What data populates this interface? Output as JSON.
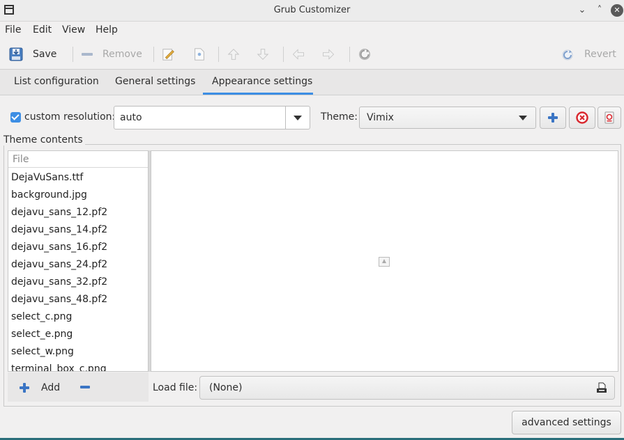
{
  "window": {
    "title": "Grub Customizer"
  },
  "menu": [
    "File",
    "Edit",
    "View",
    "Help"
  ],
  "toolbar": {
    "save_label": "Save",
    "remove_label": "Remove",
    "revert_label": "Revert"
  },
  "tabs": [
    "List configuration",
    "General settings",
    "Appearance settings"
  ],
  "appearance": {
    "custom_resolution_label": "custom resolution:",
    "custom_resolution_checked": true,
    "resolution_value": "auto",
    "theme_label": "Theme:",
    "theme_value": "Vimix"
  },
  "theme_contents": {
    "label": "Theme contents",
    "column_header": "File",
    "files": [
      "DejaVuSans.ttf",
      "background.jpg",
      "dejavu_sans_12.pf2",
      "dejavu_sans_14.pf2",
      "dejavu_sans_16.pf2",
      "dejavu_sans_24.pf2",
      "dejavu_sans_32.pf2",
      "dejavu_sans_48.pf2",
      "select_c.png",
      "select_e.png",
      "select_w.png",
      "terminal_box_c.png"
    ],
    "add_label": "Add",
    "load_file_label": "Load file:",
    "load_file_value": "(None)"
  },
  "advanced_settings_label": "advanced settings",
  "colors": {
    "accent": "#3d8ee4",
    "danger": "#d9282f",
    "icon_blue": "#3b75c4"
  }
}
